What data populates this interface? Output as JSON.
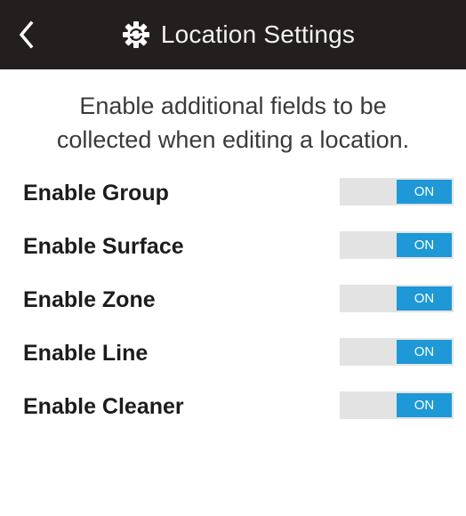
{
  "header": {
    "title": "Location Settings",
    "back_icon": "chevron-left-icon",
    "title_icon": "gear-sync-icon",
    "background": "#231f1f"
  },
  "intro": {
    "line1": "Enable additional fields to be",
    "line2": "collected when editing a location."
  },
  "settings": [
    {
      "label": "Enable Group",
      "state": "ON"
    },
    {
      "label": "Enable Surface",
      "state": "ON"
    },
    {
      "label": "Enable Zone",
      "state": "ON"
    },
    {
      "label": "Enable Line",
      "state": "ON"
    },
    {
      "label": "Enable Cleaner",
      "state": "ON"
    }
  ],
  "colors": {
    "toggle_on": "#1e98d6",
    "toggle_track": "#e3e3e3"
  }
}
